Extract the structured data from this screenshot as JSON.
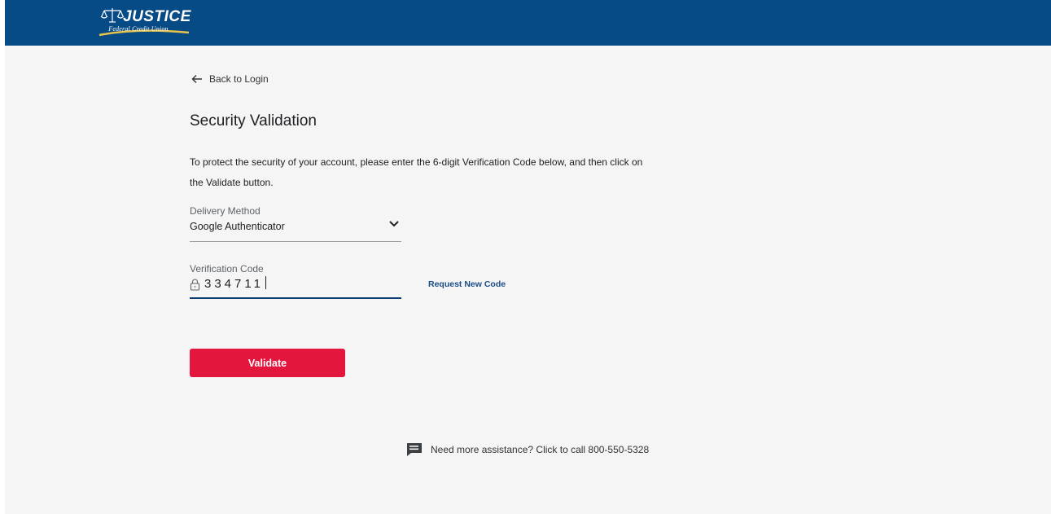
{
  "header": {
    "logo_text": "JUSTICE",
    "logo_subtitle": "Federal Credit Union"
  },
  "nav": {
    "back_label": "Back to Login"
  },
  "page": {
    "title": "Security Validation",
    "instructions": "To protect the security of your account, please enter the 6-digit Verification Code below, and then click on the Validate button."
  },
  "delivery_method": {
    "label": "Delivery Method",
    "value": "Google Authenticator"
  },
  "verification_code": {
    "label": "Verification Code",
    "value": "334711"
  },
  "request_new_code_label": "Request New Code",
  "validate_label": "Validate",
  "assistance": {
    "text": "Need more assistance? Click to call 800-550-5328"
  },
  "icons": [
    "scales-icon",
    "arrow-left-icon",
    "chevron-down-icon",
    "lock-icon",
    "chat-icon"
  ],
  "colors": {
    "header_bg": "#064a86",
    "page_bg": "#f5f5f5",
    "validate_bg": "#e3173e",
    "link": "#1a4d86",
    "logo_swoosh": "#e6c34a"
  }
}
